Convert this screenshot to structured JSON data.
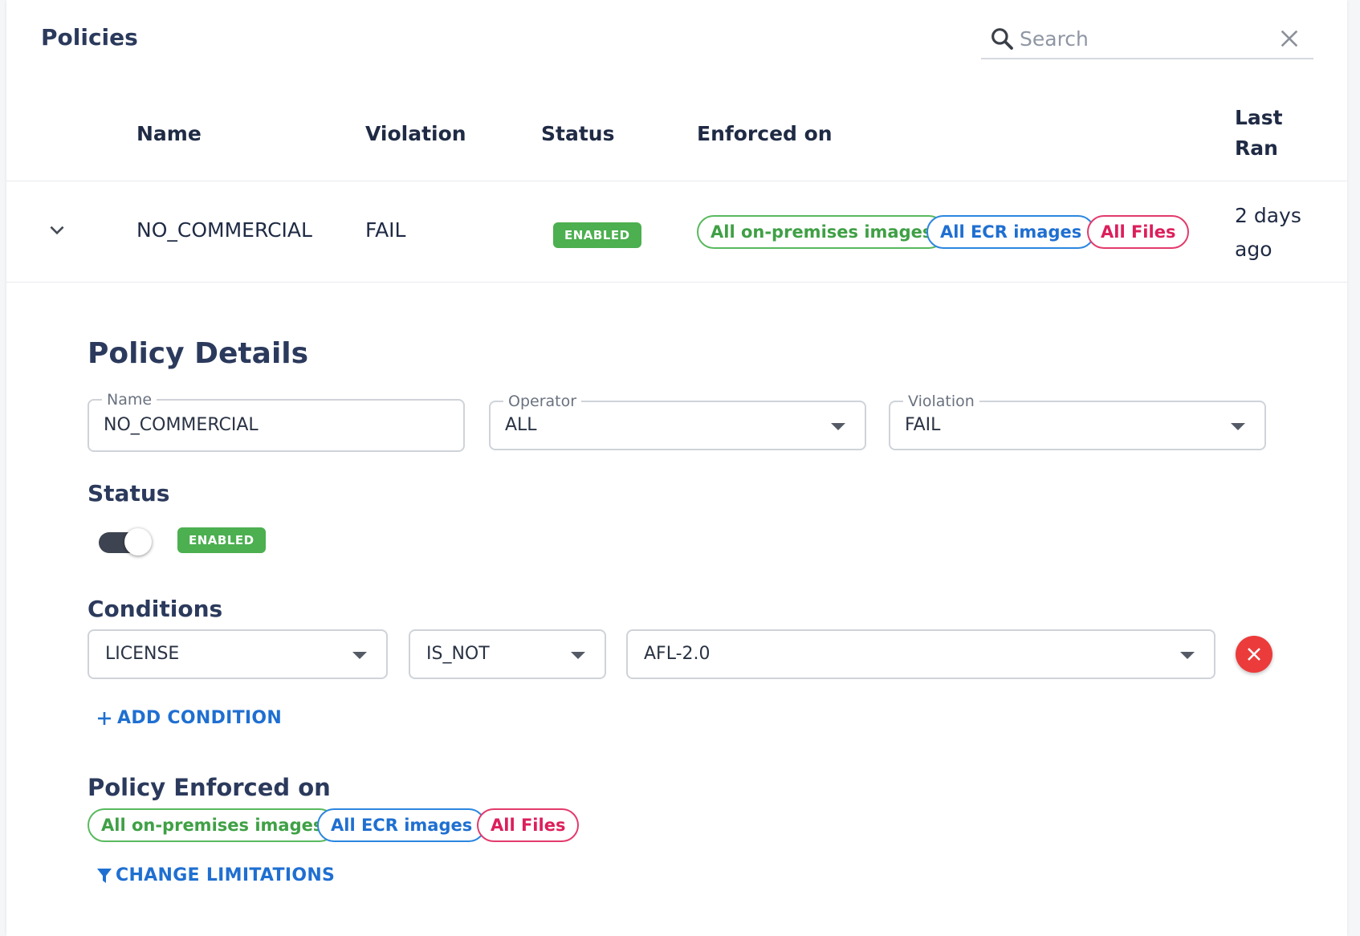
{
  "header": {
    "title": "Policies",
    "search_placeholder": "Search"
  },
  "table": {
    "columns": {
      "name": "Name",
      "violation": "Violation",
      "status": "Status",
      "enforced_on": "Enforced on",
      "last_ran_line1": "Last",
      "last_ran_line2": "Ran"
    },
    "row": {
      "name": "NO_COMMERCIAL",
      "violation": "FAIL",
      "status": "ENABLED",
      "enforced_on": [
        "All on-premises images",
        "All ECR images",
        "All Files"
      ],
      "last_ran_line1": "2 days",
      "last_ran_line2": "ago"
    }
  },
  "details": {
    "title": "Policy Details",
    "name_label": "Name",
    "name_value": "NO_COMMERCIAL",
    "operator_label": "Operator",
    "operator_value": "ALL",
    "violation_label": "Violation",
    "violation_value": "FAIL",
    "status_title": "Status",
    "status_badge": "ENABLED",
    "status_enabled": true,
    "conditions_title": "Conditions",
    "condition": {
      "field": "LICENSE",
      "op": "IS_NOT",
      "value": "AFL-2.0"
    },
    "add_condition": "ADD CONDITION",
    "enforced_title": "Policy Enforced on",
    "enforced_chips": [
      "All on-premises images",
      "All ECR images",
      "All Files"
    ],
    "change_limitations": "CHANGE LIMITATIONS"
  },
  "colors": {
    "enabled_green": "#4caf50",
    "link_blue": "#1f6fd1",
    "chip_green": "#3fa045",
    "chip_blue": "#1f6fd1",
    "chip_red": "#dc1f5b",
    "remove_red": "#ec3b3b"
  },
  "icons": {
    "search": "search-icon",
    "clear": "close-icon",
    "expand": "chevron-down-icon",
    "add": "plus-icon",
    "filter": "filter-icon",
    "remove": "close-icon"
  }
}
